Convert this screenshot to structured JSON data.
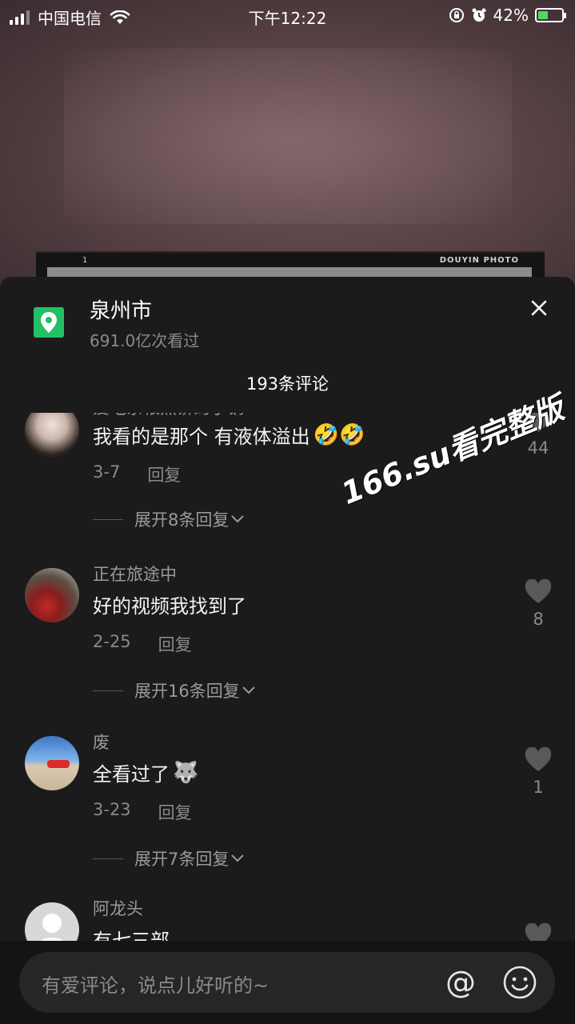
{
  "status_bar": {
    "carrier": "中国电信",
    "time": "下午12:22",
    "battery_pct": "42%",
    "battery_level": 0.42
  },
  "video": {
    "frame_number": "1",
    "brand": "DOUYIN PHOTO"
  },
  "location": {
    "name": "泉州市",
    "views": "691.0亿次看过"
  },
  "comments_header": {
    "count_label": "193条评论"
  },
  "comments": [
    {
      "username": "爱吃杂粮煎饼的小钢",
      "text": "我看的是那个 有液体溢出",
      "emoji": "🤣🤣",
      "date": "3-7",
      "reply_label": "回复",
      "likes": "44",
      "expand_label": "展开8条回复"
    },
    {
      "username": "正在旅途中",
      "text": "好的视频我找到了",
      "emoji": "",
      "date": "2-25",
      "reply_label": "回复",
      "likes": "8",
      "expand_label": "展开16条回复"
    },
    {
      "username": "废",
      "text": "全看过了",
      "emoji": "🐺",
      "date": "3-23",
      "reply_label": "回复",
      "likes": "1",
      "expand_label": "展开7条回复"
    },
    {
      "username": "阿龙头",
      "text": "有七三部",
      "emoji": "",
      "date": "",
      "reply_label": "",
      "likes": "",
      "expand_label": ""
    }
  ],
  "watermark": "166.su看完整版",
  "input": {
    "placeholder": "有爱评论，说点儿好听的~",
    "at_symbol": "@"
  },
  "icons": {
    "location": "map-pin-icon",
    "close": "close-icon",
    "like": "heart-icon",
    "expand": "chevron-down-icon",
    "emoji": "smiley-icon"
  },
  "colors": {
    "panel_bg": "#1b1b1b",
    "location_badge": "#21c064",
    "battery_fill": "#4cd964"
  }
}
